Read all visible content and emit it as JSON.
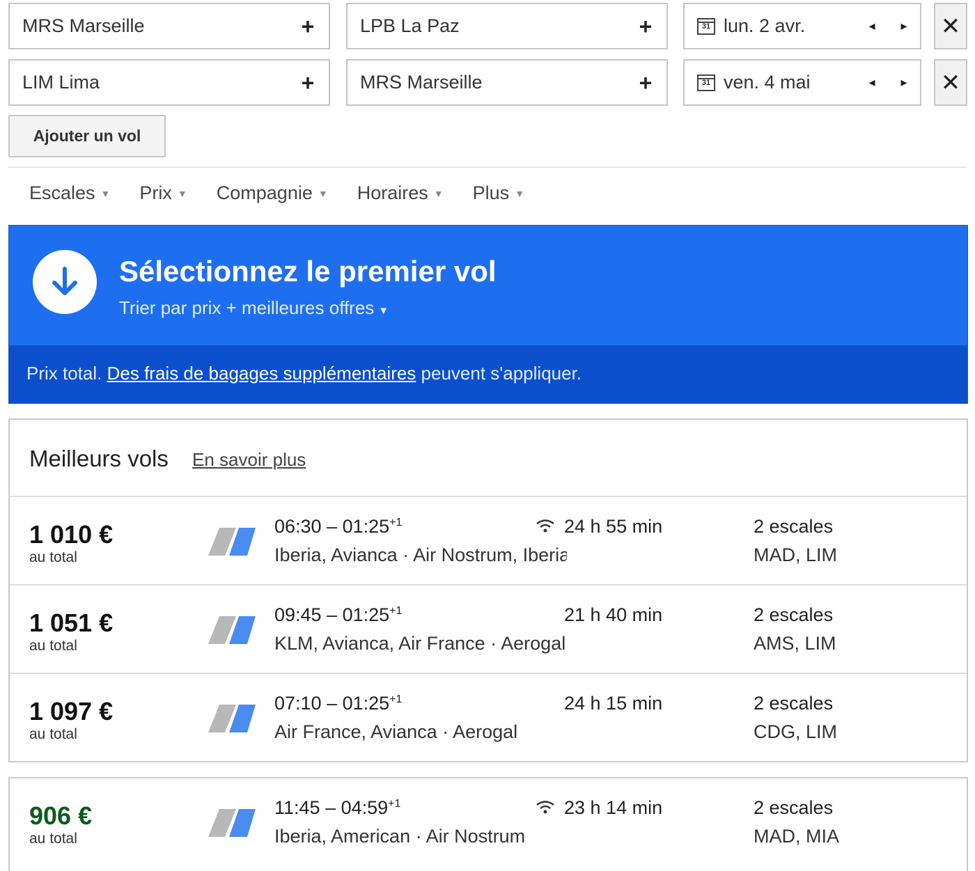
{
  "search": {
    "legs": [
      {
        "origin": "MRS Marseille",
        "destination": "LPB La Paz",
        "date": "lun. 2 avr."
      },
      {
        "origin": "LIM Lima",
        "destination": "MRS Marseille",
        "date": "ven. 4 mai"
      }
    ],
    "plus_glyph": "+",
    "calendar_glyph": "31",
    "prev_glyph": "◂",
    "next_glyph": "▸",
    "remove_glyph": "✕",
    "add_flight_label": "Ajouter un vol"
  },
  "filters": [
    {
      "label": "Escales"
    },
    {
      "label": "Prix"
    },
    {
      "label": "Compagnie"
    },
    {
      "label": "Horaires"
    },
    {
      "label": "Plus"
    }
  ],
  "banner": {
    "title": "Sélectionnez le premier vol",
    "sort_label": "Trier par prix + meilleures offres",
    "note_prefix": "Prix total.",
    "note_link": "Des frais de bagages supplémentaires",
    "note_suffix": "peuvent s'appliquer.",
    "color_top": "#1e6ff0",
    "color_bottom": "#0b4fcc"
  },
  "best": {
    "title": "Meilleurs vols",
    "learn_more": "En savoir plus",
    "flights": [
      {
        "price": "1 010 €",
        "total": "au total",
        "times": "06:30 – 01:25",
        "day_offset": "+1",
        "wifi": true,
        "duration": "24 h 55 min",
        "airlines": "Iberia, Avianca · Air Nostrum, Iberia",
        "stops": "2 escales",
        "stop_codes": "MAD, LIM"
      },
      {
        "price": "1 051 €",
        "total": "au total",
        "times": "09:45 – 01:25",
        "day_offset": "+1",
        "wifi": false,
        "duration": "21 h 40 min",
        "airlines": "KLM, Avianca, Air France · Aerogal",
        "stops": "2 escales",
        "stop_codes": "AMS, LIM"
      },
      {
        "price": "1 097 €",
        "total": "au total",
        "times": "07:10 – 01:25",
        "day_offset": "+1",
        "wifi": false,
        "duration": "24 h 15 min",
        "airlines": "Air France, Avianca · Aerogal",
        "stops": "2 escales",
        "stop_codes": "CDG, LIM"
      }
    ]
  },
  "other": {
    "flights": [
      {
        "price": "906 €",
        "total": "au total",
        "times": "11:45 – 04:59",
        "day_offset": "+1",
        "wifi": true,
        "duration": "23 h 14 min",
        "airlines": "Iberia, American · Air Nostrum",
        "stops": "2 escales",
        "stop_codes": "MAD, MIA",
        "price_color": "#0d5b1c"
      }
    ]
  }
}
